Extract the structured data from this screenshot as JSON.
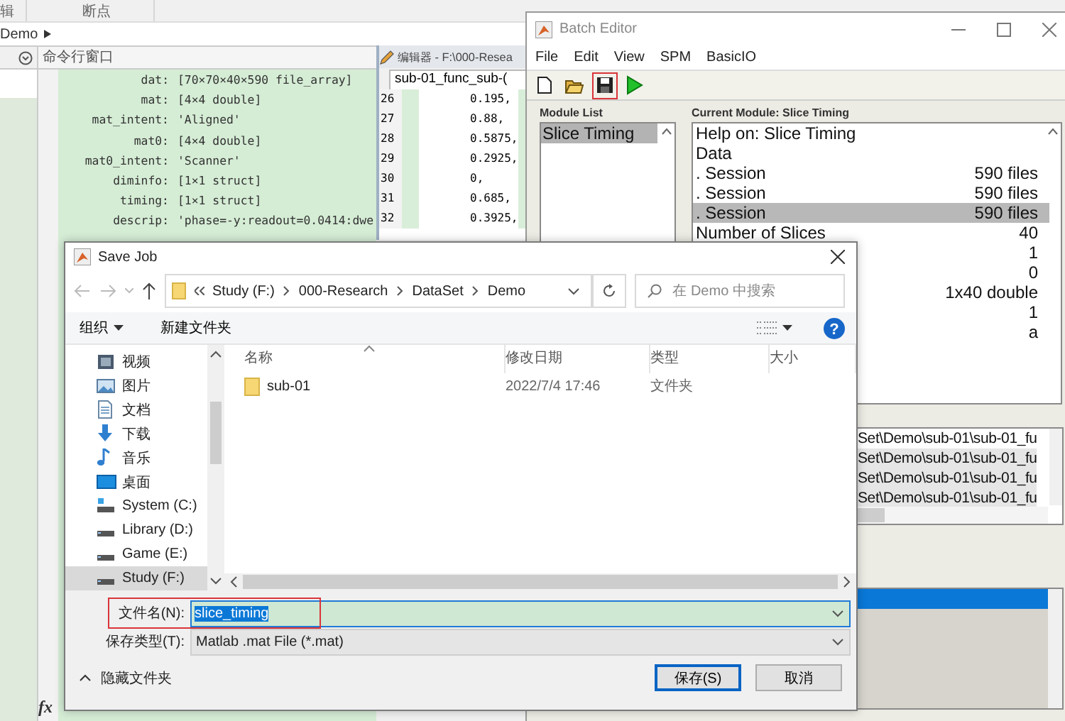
{
  "matlab": {
    "toolstrip_tabs": [
      {
        "label": "辑"
      },
      {
        "label": "断点"
      }
    ],
    "address": "Demo",
    "command_window": {
      "title": "命令行窗口",
      "rows": [
        {
          "field": "dat:",
          "value": "[70×70×40×590 file_array]"
        },
        {
          "field": "mat:",
          "value": "[4×4 double]"
        },
        {
          "field": "mat_intent:",
          "value": "'Aligned'"
        },
        {
          "field": "mat0:",
          "value": "[4×4 double]"
        },
        {
          "field": "mat0_intent:",
          "value": "'Scanner'"
        },
        {
          "field": "diminfo:",
          "value": "[1×1 struct]"
        },
        {
          "field": "timing:",
          "value": "[1×1 struct]"
        },
        {
          "field": "descrip:",
          "value": "'phase=-y:readout=0.0414:dwe"
        }
      ],
      "prompt": "fx"
    }
  },
  "editor": {
    "title": "编辑器 - F:\\000-Resea",
    "tab": "sub-01_func_sub-(",
    "lines": [
      {
        "number": "26",
        "code": "0.195,"
      },
      {
        "number": "27",
        "code": "0.88,"
      },
      {
        "number": "28",
        "code": "0.5875,"
      },
      {
        "number": "29",
        "code": "0.2925,"
      },
      {
        "number": "30",
        "code": "0,"
      },
      {
        "number": "31",
        "code": "0.685,"
      },
      {
        "number": "32",
        "code": "0.3925,"
      }
    ]
  },
  "batch_editor": {
    "title": "Batch Editor",
    "menu": [
      "File",
      "Edit",
      "View",
      "SPM",
      "BasicIO"
    ],
    "toolbar": [
      {
        "kind": "new",
        "highlighted": false
      },
      {
        "kind": "open",
        "highlighted": false
      },
      {
        "kind": "save",
        "highlighted": true
      },
      {
        "kind": "run",
        "highlighted": false
      }
    ],
    "module_list": {
      "title": "Module List",
      "items": [
        {
          "label": "Slice Timing",
          "selected": true
        }
      ]
    },
    "current_module": {
      "title": "Current Module: Slice Timing",
      "rows": [
        {
          "label": "Help on: Slice Timing",
          "selected": false
        },
        {
          "label": "Data",
          "selected": false
        },
        {
          "label": ". Session",
          "value": "590 files",
          "selected": false
        },
        {
          "label": ". Session",
          "value": "590 files",
          "selected": false
        },
        {
          "label": ". Session",
          "value": "590 files",
          "selected": true
        },
        {
          "label": "Number of Slices",
          "value": "40",
          "selected": false
        },
        {
          "value": "1",
          "selected": false
        },
        {
          "value": "0",
          "selected": false
        },
        {
          "value": "1x40 double",
          "selected": false
        },
        {
          "value": "1",
          "selected": false
        },
        {
          "value": "a",
          "selected": false
        }
      ]
    },
    "file_paths": [
      {
        "text": "Set\\Demo\\sub-01\\sub-01_fu",
        "selected": false
      },
      {
        "text": "Set\\Demo\\sub-01\\sub-01_fu",
        "selected": true
      },
      {
        "text": "Set\\Demo\\sub-01\\sub-01_fu",
        "selected": true
      },
      {
        "text": "Set\\Demo\\sub-01\\sub-01_fu",
        "selected": true
      }
    ],
    "lower_list": [
      {
        "selected": true
      }
    ]
  },
  "save_dialog": {
    "title": "Save Job",
    "breadcrumb": [
      "Study (F:)",
      "000-Research",
      "DataSet",
      "Demo"
    ],
    "search": {
      "placeholder": "在 Demo 中搜索"
    },
    "toolbar": {
      "organize": "组织",
      "new_folder": "新建文件夹",
      "help": "?"
    },
    "nav_items": [
      {
        "label": "视频",
        "kind": "video",
        "selected": false
      },
      {
        "label": "图片",
        "kind": "pictures",
        "selected": false
      },
      {
        "label": "文档",
        "kind": "documents",
        "selected": false
      },
      {
        "label": "下载",
        "kind": "downloads",
        "selected": false
      },
      {
        "label": "音乐",
        "kind": "music",
        "selected": false
      },
      {
        "label": "桌面",
        "kind": "desktop",
        "selected": false
      },
      {
        "label": "System (C:)",
        "kind": "system_drive",
        "selected": false
      },
      {
        "label": "Library (D:)",
        "kind": "drive",
        "selected": false
      },
      {
        "label": "Game (E:)",
        "kind": "drive",
        "selected": false
      },
      {
        "label": "Study (F:)",
        "kind": "drive",
        "selected": true
      }
    ],
    "columns": [
      "名称",
      "修改日期",
      "类型",
      "大小"
    ],
    "files": [
      {
        "name": "sub-01",
        "modified": "2022/7/4 17:46",
        "type": "文件夹"
      }
    ],
    "filename": {
      "label": "文件名(N):",
      "value": "slice_timing",
      "text_selected": true,
      "highlighted": true
    },
    "file_type": {
      "label": "保存类型(T):",
      "value": "Matlab .mat File (*.mat)"
    },
    "hide_folders": "隐藏文件夹",
    "buttons": [
      {
        "label": "保存(S)",
        "default": true
      },
      {
        "label": "取消",
        "default": false
      }
    ]
  }
}
